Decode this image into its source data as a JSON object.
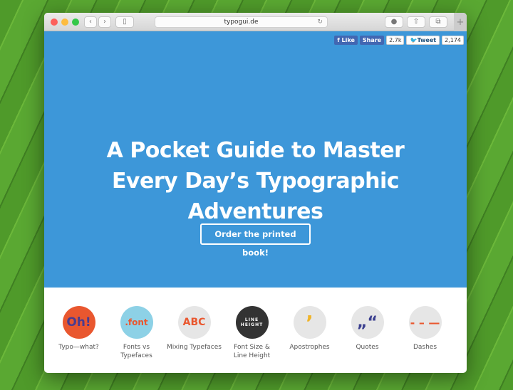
{
  "browser": {
    "url": "typogui.de"
  },
  "social": {
    "like": "Like",
    "share": "Share",
    "share_count": "2.7k",
    "tweet": "Tweet",
    "tweet_count": "2,174"
  },
  "hero": {
    "title_lines": [
      "A Pocket Guide to Master",
      "Every Day’s Typographic",
      "Adventures"
    ],
    "cta": "Order the printed book!",
    "bg_color": "#3d97d9"
  },
  "categories": [
    {
      "label": "Typo—what?",
      "icon_text": "Oh!"
    },
    {
      "label": "Fonts vs Typefaces",
      "icon_text": ".font"
    },
    {
      "label": "Mixing Typefaces",
      "icon_text": "ABC"
    },
    {
      "label": "Font Size & Line Height",
      "icon_text": "LINE HEIGHT"
    },
    {
      "label": "Apostrophes",
      "icon_text": "’"
    },
    {
      "label": "Quotes",
      "icon_text": "„“"
    },
    {
      "label": "Dashes",
      "icon_text": "- – —"
    }
  ]
}
